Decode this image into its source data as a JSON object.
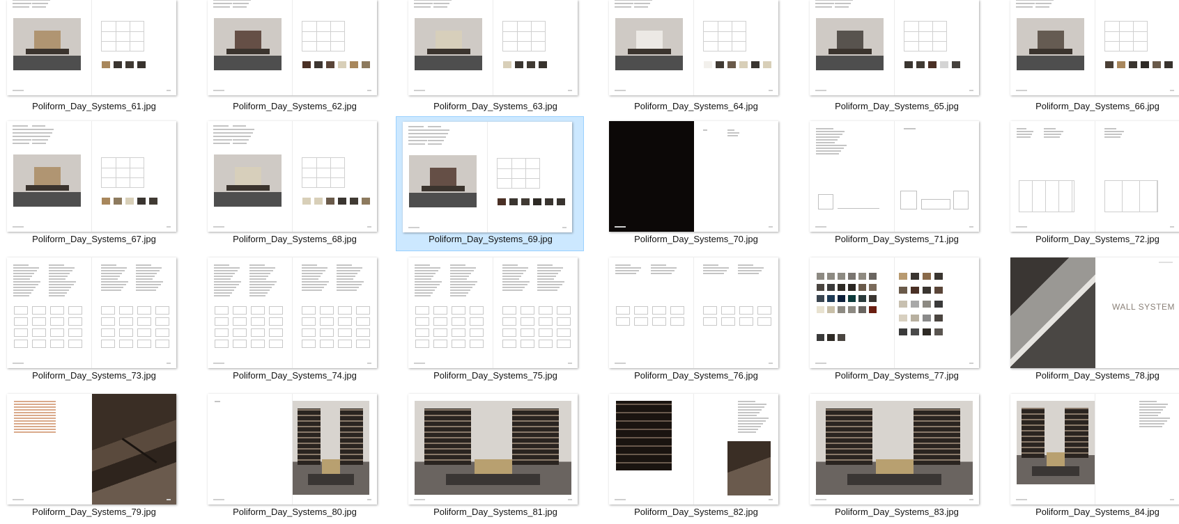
{
  "files": [
    {
      "name": "Poliform_Day_Systems_61.jpg",
      "layout": "sheet",
      "swatches": [
        "#a8875c",
        "#3a3530",
        "#403a33",
        "#38332e"
      ]
    },
    {
      "name": "Poliform_Day_Systems_62.jpg",
      "layout": "sheet",
      "swatches": [
        "#4a3025",
        "#3d3631",
        "#5a4538",
        "#d8cfb8",
        "#a8875c",
        "#8d7a5e"
      ]
    },
    {
      "name": "Poliform_Day_Systems_63.jpg",
      "layout": "sheet",
      "swatches": [
        "#d8cfb8",
        "#3a3530",
        "#403a33",
        "#38332e"
      ]
    },
    {
      "name": "Poliform_Day_Systems_64.jpg",
      "layout": "sheet",
      "swatches": [
        "#f2f0ec",
        "#403a33",
        "#6a5a4a",
        "#d8cfb8",
        "#3a3530",
        "#d8cfb8"
      ]
    },
    {
      "name": "Poliform_Day_Systems_65.jpg",
      "layout": "sheet",
      "swatches": [
        "#3a3530",
        "#403a33",
        "#4a3025",
        "#d4d4d4",
        "#45413c"
      ]
    },
    {
      "name": "Poliform_Day_Systems_66.jpg",
      "layout": "sheet",
      "swatches": [
        "#4a3f35",
        "#a8875c",
        "#3a3530",
        "#2e2a25",
        "#6a5a4a",
        "#38332e"
      ]
    },
    {
      "name": "Poliform_Day_Systems_67.jpg",
      "layout": "sheet",
      "swatches": [
        "#a8875c",
        "#8d7a5e",
        "#d8cfb8",
        "#3a3530",
        "#403a33"
      ]
    },
    {
      "name": "Poliform_Day_Systems_68.jpg",
      "layout": "sheet",
      "swatches": [
        "#d8cfb8",
        "#d8cfb8",
        "#6a5a4a",
        "#3a3530",
        "#403a33",
        "#8d7a5e"
      ]
    },
    {
      "name": "Poliform_Day_Systems_69.jpg",
      "layout": "sheet",
      "selected": true,
      "swatches": [
        "#4a3025",
        "#3a3530",
        "#403a33",
        "#2e2a25",
        "#3a3530",
        "#38332e"
      ]
    },
    {
      "name": "Poliform_Day_Systems_70.jpg",
      "layout": "black"
    },
    {
      "name": "Poliform_Day_Systems_71.jpg",
      "layout": "drawing"
    },
    {
      "name": "Poliform_Day_Systems_72.jpg",
      "layout": "panels"
    },
    {
      "name": "Poliform_Day_Systems_73.jpg",
      "layout": "diagrams"
    },
    {
      "name": "Poliform_Day_Systems_74.jpg",
      "layout": "diagrams"
    },
    {
      "name": "Poliform_Day_Systems_75.jpg",
      "layout": "diagrams"
    },
    {
      "name": "Poliform_Day_Systems_76.jpg",
      "layout": "diagrams-light"
    },
    {
      "name": "Poliform_Day_Systems_77.jpg",
      "layout": "palette"
    },
    {
      "name": "Poliform_Day_Systems_78.jpg",
      "layout": "wall",
      "wall_text": "WALL SYSTEM"
    },
    {
      "name": "Poliform_Day_Systems_79.jpg",
      "layout": "detail"
    },
    {
      "name": "Poliform_Day_Systems_80.jpg",
      "layout": "room-right"
    },
    {
      "name": "Poliform_Day_Systems_81.jpg",
      "layout": "room-full"
    },
    {
      "name": "Poliform_Day_Systems_82.jpg",
      "layout": "collage"
    },
    {
      "name": "Poliform_Day_Systems_83.jpg",
      "layout": "room-full2"
    },
    {
      "name": "Poliform_Day_Systems_84.jpg",
      "layout": "room-left"
    }
  ]
}
